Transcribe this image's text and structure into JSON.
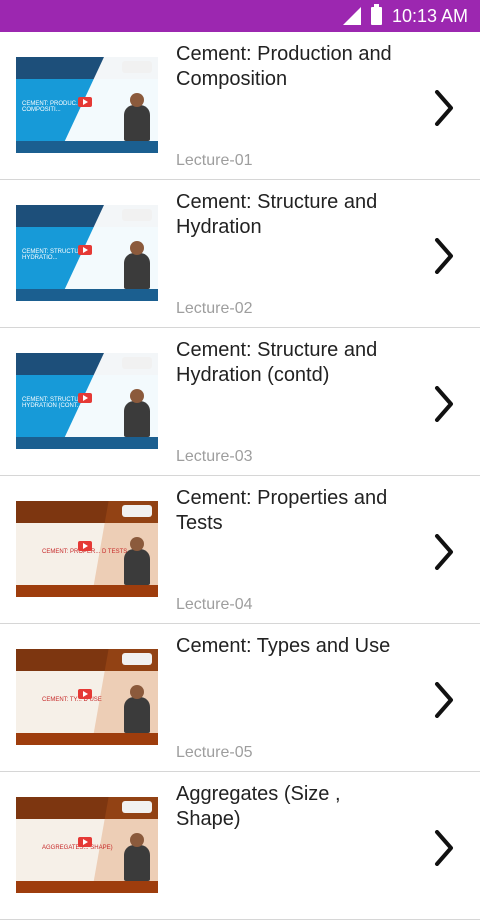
{
  "status": {
    "time": "10:13 AM",
    "signal_icon": "signal-icon",
    "battery_icon": "battery-icon"
  },
  "items": [
    {
      "title": "Cement: Production and Composition",
      "lecture": "Lecture-01",
      "thumb_style": "blue"
    },
    {
      "title": "Cement: Structure and Hydration",
      "lecture": "Lecture-02",
      "thumb_style": "blue"
    },
    {
      "title": "Cement: Structure and Hydration (contd)",
      "lecture": "Lecture-03",
      "thumb_style": "blue"
    },
    {
      "title": "Cement: Properties and Tests",
      "lecture": "Lecture-04",
      "thumb_style": "orange"
    },
    {
      "title": "Cement: Types and Use",
      "lecture": "Lecture-05",
      "thumb_style": "orange"
    },
    {
      "title": "Aggregates (Size , Shape)",
      "lecture": "",
      "thumb_style": "orange"
    }
  ],
  "thumb_captions": [
    "CEMENT: PRODUC... AND COMPOSITI...",
    "CEMENT: STRUCTU... D HYDRATIO...",
    "CEMENT: STRUCTU... D HYDRATION (CONT...",
    "CEMENT: PROPER... D TESTS",
    "CEMENT: TY... D USE",
    "AGGREGATES... SHAPE)"
  ]
}
